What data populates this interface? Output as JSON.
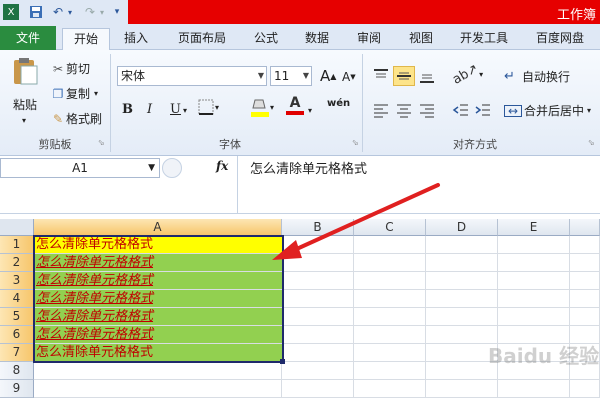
{
  "window": {
    "title": "工作簿"
  },
  "qat": {
    "app_icon": "excel-icon",
    "save": "save-icon",
    "undo": "undo-icon",
    "redo": "redo-icon",
    "customize": "customize-qat-icon"
  },
  "tabs": [
    "文件",
    "开始",
    "插入",
    "页面布局",
    "公式",
    "数据",
    "审阅",
    "视图",
    "开发工具",
    "百度网盘"
  ],
  "clipboard": {
    "paste": "粘贴",
    "cut": "剪切",
    "copy": "复制",
    "format_painter": "格式刷",
    "label": "剪贴板"
  },
  "font": {
    "name": "宋体",
    "size": "11",
    "bold": "B",
    "italic": "I",
    "underline": "U",
    "label": "字体",
    "grow": "A",
    "shrink": "A",
    "wen": "wén",
    "fill_icon": "fill-color-icon",
    "font_color_icon": "font-color-icon"
  },
  "alignment": {
    "wrap": "自动换行",
    "merge": "合并后居中",
    "label": "对齐方式"
  },
  "formula_bar": {
    "cell_ref": "A1",
    "fx": "fx",
    "content": "怎么清除单元格格式"
  },
  "grid": {
    "columns": [
      "A",
      "B",
      "C",
      "D",
      "E"
    ],
    "rows": [
      "1",
      "2",
      "3",
      "4",
      "5",
      "6",
      "7",
      "8",
      "9"
    ],
    "cells": [
      "怎么清除单元格格式",
      "怎么清除单元格格式",
      "怎么清除单元格格式",
      "怎么清除单元格格式",
      "怎么清除单元格格式",
      "怎么清除单元格格式",
      "怎么清除单元格格式"
    ]
  },
  "colors": {
    "title_red": "#e60000",
    "file_tab": "#2a8c3f",
    "yellow_fill": "#ffff00",
    "green_fill": "#92d050",
    "text_red": "#c00000",
    "arrow": "#e02020"
  },
  "watermark": "Baidu 经验"
}
